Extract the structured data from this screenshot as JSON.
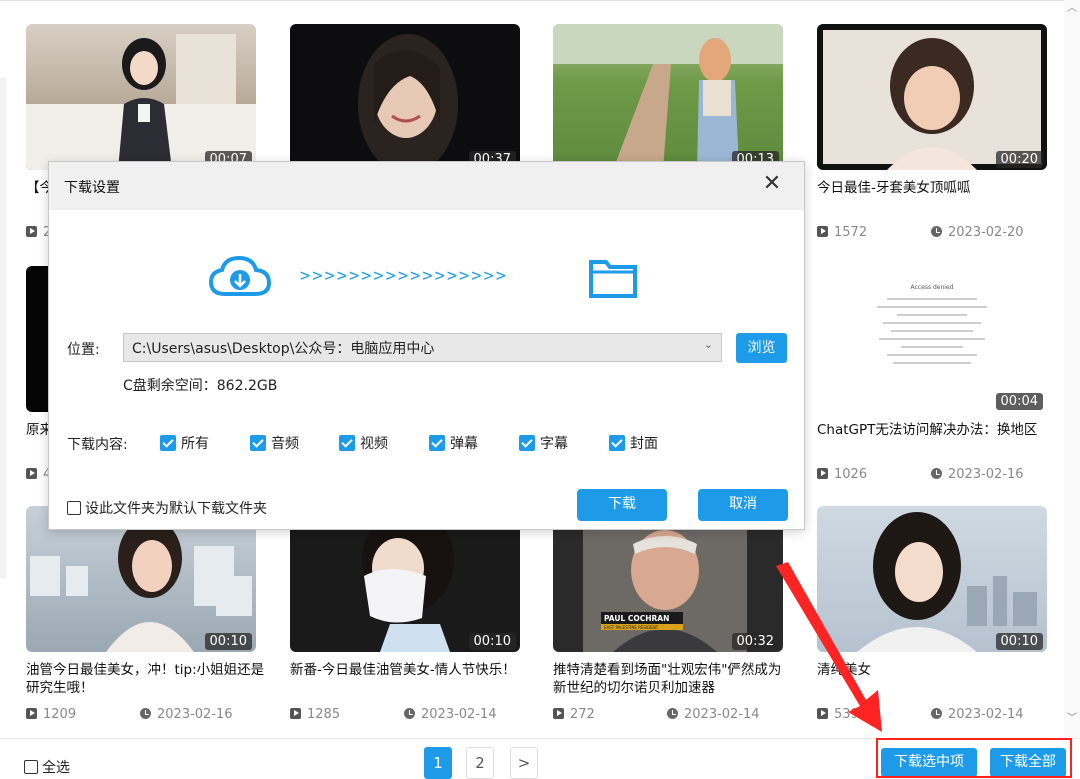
{
  "videos": [
    {
      "title": "【今",
      "duration": "00:07",
      "views": "2",
      "date": ""
    },
    {
      "title": "",
      "duration": "00:37",
      "views": "",
      "date": ""
    },
    {
      "title": "",
      "duration": "00:13",
      "views": "",
      "date": ""
    },
    {
      "title": "今日最佳-牙套美女顶呱呱",
      "duration": "00:20",
      "views": "1572",
      "date": "2023-02-20"
    },
    {
      "title": "原来",
      "duration": "",
      "views": "4",
      "date": ""
    },
    {
      "title": "ChatGPT无法访问解决办法：换地区",
      "duration": "00:04",
      "views": "1026",
      "date": "2023-02-16",
      "thumb_text": "Access denied"
    },
    {
      "title": "油管今日最佳美女，冲！tip:小姐姐还是研究生哦！",
      "duration": "00:10",
      "views": "1209",
      "date": "2023-02-16"
    },
    {
      "title": "新番-今日最佳油管美女-情人节快乐！",
      "duration": "00:10",
      "views": "1285",
      "date": "2023-02-14"
    },
    {
      "title": "推特清楚看到场面\"壮观宏伟\"俨然成为新世纪的切尔诺贝利加速器",
      "duration": "00:32",
      "views": "272",
      "date": "2023-02-14",
      "thumb_caption": "PAUL COCHRAN",
      "thumb_subcaption": "EAST PALESTINE RESIDENT"
    },
    {
      "title": "清纯美女",
      "duration": "00:10",
      "views": "539",
      "date": "2023-02-14"
    }
  ],
  "dialog": {
    "title": "下载设置",
    "close": "✕",
    "arrows": ">>>>>>>>>>>>>>>>>",
    "location_label": "位置:",
    "path_value": "C:\\Users\\asus\\Desktop\\公众号：电脑应用中心",
    "browse_label": "浏览",
    "space_text": "C盘剩余空间：862.2GB",
    "content_label": "下载内容:",
    "options": [
      "所有",
      "音频",
      "视频",
      "弹幕",
      "字幕",
      "封面"
    ],
    "default_folder_label": "设此文件夹为默认下载文件夹",
    "download_label": "下载",
    "cancel_label": "取消"
  },
  "footer": {
    "select_all": "全选",
    "pages": [
      "1",
      "2"
    ],
    "next": ">",
    "download_selected": "下载选中项",
    "download_all": "下载全部"
  },
  "colors": {
    "accent": "#1e9be8",
    "highlight": "#ff2020"
  },
  "icons": [
    "play-count-icon",
    "clock-icon",
    "cloud-download-icon",
    "folder-icon",
    "close-icon",
    "checkbox-icon",
    "red-arrow"
  ]
}
